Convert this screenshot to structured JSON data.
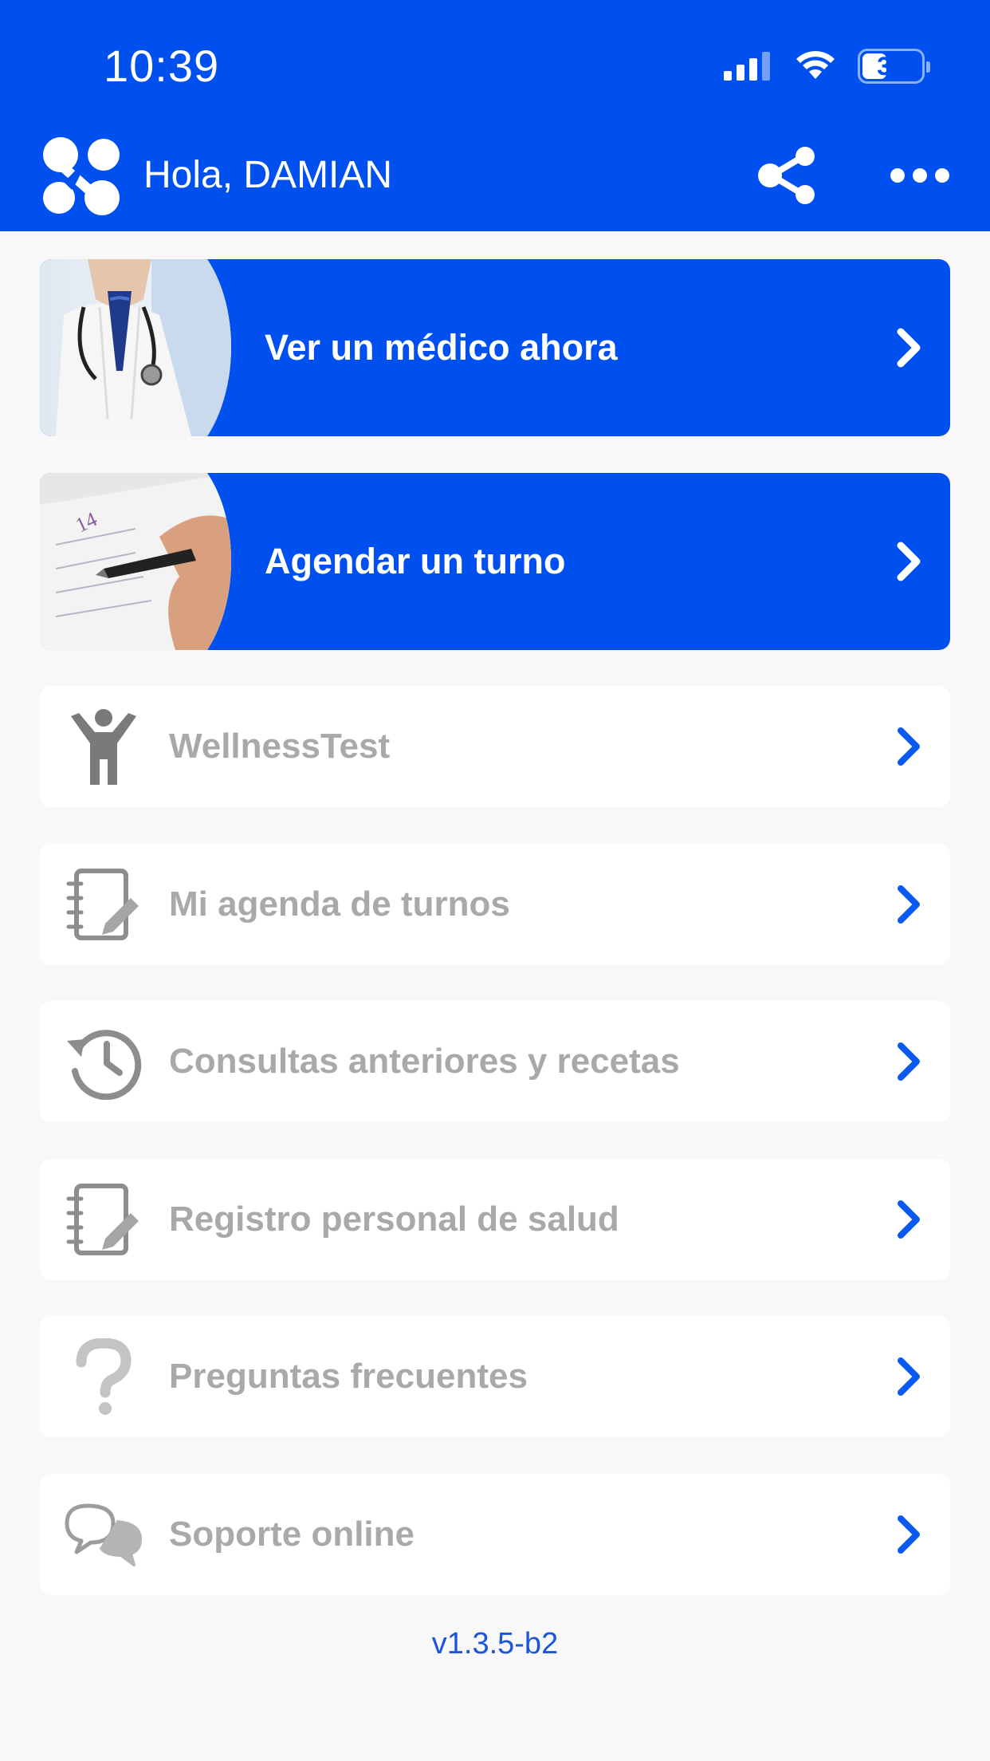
{
  "status": {
    "time": "10:39",
    "battery": "37"
  },
  "header": {
    "greeting": "Hola, DAMIAN"
  },
  "primary_cards": [
    {
      "label": "Ver un médico ahora"
    },
    {
      "label": "Agendar un turno"
    }
  ],
  "menu": [
    {
      "label": "WellnessTest",
      "icon": "person-icon"
    },
    {
      "label": "Mi agenda de turnos",
      "icon": "notebook-edit-icon"
    },
    {
      "label": "Consultas anteriores y recetas",
      "icon": "history-icon"
    },
    {
      "label": "Registro personal de salud",
      "icon": "notebook-edit-icon"
    },
    {
      "label": "Preguntas frecuentes",
      "icon": "question-icon"
    },
    {
      "label": "Soporte online",
      "icon": "chat-bubbles-icon"
    }
  ],
  "footer": {
    "version": "v1.3.5-b2"
  },
  "colors": {
    "brand_blue": "#0050f0",
    "menu_text": "#a9a9a9",
    "chevron_blue": "#0a5af0"
  }
}
